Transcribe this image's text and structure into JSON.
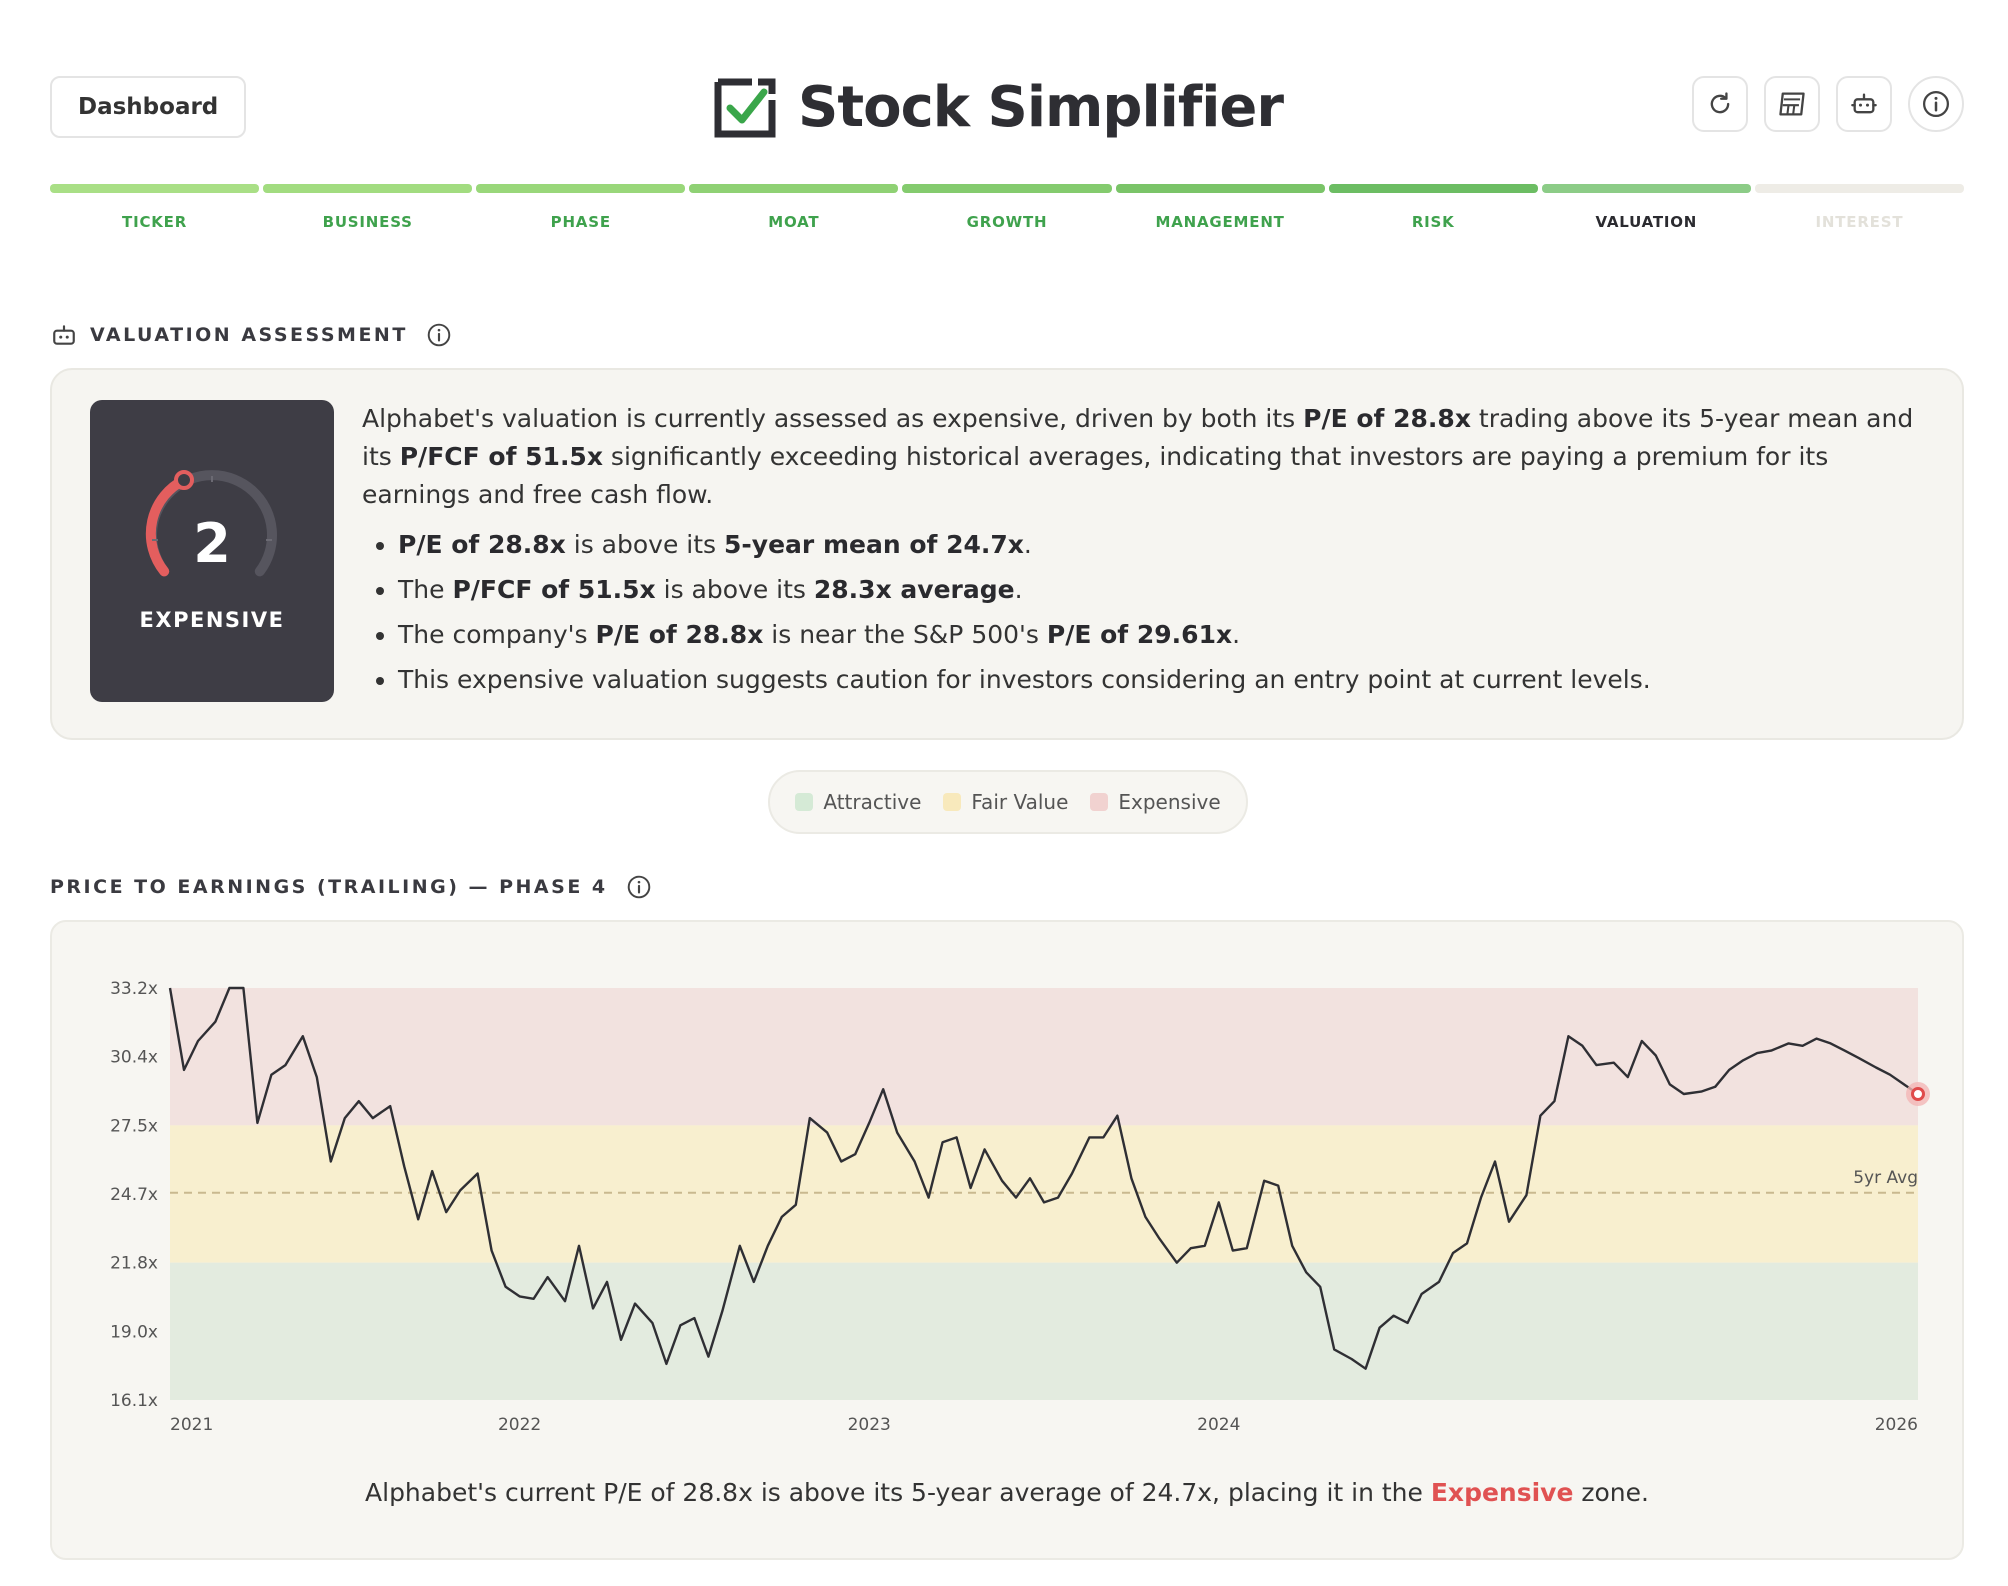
{
  "header": {
    "dashboard_label": "Dashboard",
    "brand_title": "Stock Simplifier",
    "icons": [
      "refresh-icon",
      "calculator-icon",
      "robot-icon",
      "info-icon"
    ]
  },
  "steps": [
    {
      "label": "TICKER",
      "state": "done"
    },
    {
      "label": "BUSINESS",
      "state": "done"
    },
    {
      "label": "PHASE",
      "state": "done"
    },
    {
      "label": "MOAT",
      "state": "done"
    },
    {
      "label": "GROWTH",
      "state": "done"
    },
    {
      "label": "MANAGEMENT",
      "state": "done"
    },
    {
      "label": "RISK",
      "state": "done"
    },
    {
      "label": "VALUATION",
      "state": "current"
    },
    {
      "label": "INTEREST",
      "state": "todo"
    }
  ],
  "assessment": {
    "section_title": "VALUATION ASSESSMENT",
    "score": "2",
    "score_label": "EXPENSIVE",
    "summary": {
      "t1": "Alphabet's valuation is currently assessed as expensive, driven by both its ",
      "b1": "P/E of 28.8x",
      "t2": " trading above its 5-year mean and its ",
      "b2": "P/FCF of 51.5x",
      "t3": " significantly exceeding historical averages, indicating that investors are paying a premium for its earnings and free cash flow."
    },
    "bullets": [
      {
        "b1": "P/E of 28.8x",
        "t1": " is above its ",
        "b2": "5-year mean of 24.7x",
        "t2": "."
      },
      {
        "t0": "The ",
        "b1": "P/FCF of 51.5x",
        "t1": " is above its ",
        "b2": "28.3x average",
        "t2": "."
      },
      {
        "t0": "The company's ",
        "b1": "P/E of 28.8x",
        "t1": " is near the S&P 500's ",
        "b2": "P/E of 29.61x",
        "t2": "."
      },
      {
        "t0": "This expensive valuation suggests caution for investors considering an entry point at current levels."
      }
    ]
  },
  "legend": [
    {
      "label": "Attractive",
      "color": "#d5ead6"
    },
    {
      "label": "Fair Value",
      "color": "#f8e9bc"
    },
    {
      "label": "Expensive",
      "color": "#f1d2d0"
    }
  ],
  "chart_section_title": "PRICE TO EARNINGS (TRAILING) — PHASE 4",
  "chart_data": {
    "type": "line",
    "y_ticks": [
      "33.2x",
      "30.4x",
      "27.5x",
      "24.7x",
      "21.8x",
      "19.0x",
      "16.1x"
    ],
    "x_ticks": [
      "2021",
      "2022",
      "2023",
      "2024",
      "2026"
    ],
    "ylim": [
      16.1,
      33.2
    ],
    "zones": [
      {
        "name": "Expensive",
        "from": 27.5,
        "to": 33.2,
        "color": "#f2e2df"
      },
      {
        "name": "Fair Value",
        "from": 21.8,
        "to": 27.5,
        "color": "#f8efcf"
      },
      {
        "name": "Attractive",
        "from": 16.1,
        "to": 21.8,
        "color": "#e3ebdf"
      }
    ],
    "avg": {
      "label": "5yr Avg",
      "value": 24.7
    },
    "current": 28.8,
    "series": [
      {
        "x": [
          2021.0,
          2021.04,
          2021.08,
          2021.13,
          2021.17,
          2021.21,
          2021.25,
          2021.29,
          2021.33,
          2021.38,
          2021.42,
          2021.46,
          2021.5,
          2021.54,
          2021.58,
          2021.63,
          2021.67,
          2021.71,
          2021.75,
          2021.79,
          2021.83,
          2021.88,
          2021.92,
          2021.96,
          2022.0,
          2022.04,
          2022.08,
          2022.13,
          2022.17,
          2022.21,
          2022.25,
          2022.29,
          2022.33,
          2022.38,
          2022.42,
          2022.46,
          2022.5,
          2022.54,
          2022.58,
          2022.63,
          2022.67,
          2022.71,
          2022.75,
          2022.79,
          2022.83,
          2022.88,
          2022.92,
          2022.96,
          2023.0,
          2023.04,
          2023.08,
          2023.13,
          2023.17,
          2023.21,
          2023.25,
          2023.29,
          2023.33,
          2023.38,
          2023.42,
          2023.46,
          2023.5,
          2023.54,
          2023.58,
          2023.63,
          2023.67,
          2023.71,
          2023.75,
          2023.79,
          2023.83,
          2023.88,
          2023.92,
          2023.96,
          2024.0,
          2024.04,
          2024.08,
          2024.13,
          2024.17,
          2024.21,
          2024.25,
          2024.29,
          2024.33,
          2024.38,
          2024.42,
          2024.46,
          2024.5,
          2024.54,
          2024.58,
          2024.63,
          2024.67,
          2024.71,
          2024.75,
          2024.79,
          2024.83,
          2024.88,
          2024.92,
          2024.96,
          2025.0,
          2025.04,
          2025.08,
          2025.13,
          2025.17,
          2025.21,
          2025.25,
          2025.29,
          2025.33,
          2025.38,
          2025.42,
          2025.46,
          2025.5,
          2025.54,
          2025.58,
          2025.63,
          2025.67,
          2025.71,
          2025.75,
          2025.79,
          2025.83,
          2025.88,
          2025.92,
          2025.96,
          2026.0
        ],
        "values": [
          33.2,
          29.8,
          31.0,
          31.8,
          33.2,
          33.2,
          27.6,
          29.6,
          30.0,
          31.2,
          29.5,
          26.0,
          27.8,
          28.5,
          27.8,
          28.3,
          25.8,
          23.6,
          25.6,
          23.9,
          24.8,
          25.5,
          22.3,
          20.8,
          20.4,
          20.3,
          21.2,
          20.2,
          22.5,
          19.9,
          21.0,
          18.6,
          20.1,
          19.3,
          17.6,
          19.2,
          19.5,
          17.9,
          19.8,
          22.5,
          21.0,
          22.5,
          23.7,
          24.2,
          27.8,
          27.2,
          26.0,
          26.3,
          27.6,
          29.0,
          27.2,
          26.0,
          24.5,
          26.8,
          27.0,
          24.9,
          26.5,
          25.2,
          24.5,
          25.3,
          24.3,
          24.5,
          25.5,
          27.0,
          27.0,
          27.9,
          25.3,
          23.7,
          22.8,
          21.8,
          22.4,
          22.5,
          24.3,
          22.3,
          22.4,
          25.2,
          25.0,
          22.5,
          21.4,
          20.8,
          18.2,
          17.8,
          17.4,
          19.1,
          19.6,
          19.3,
          20.5,
          21.0,
          22.2,
          22.6,
          24.5,
          26.0,
          23.5,
          24.6,
          27.9,
          28.5,
          31.2,
          30.8,
          30.0,
          30.1,
          29.5,
          31.0,
          30.4,
          29.2,
          28.8,
          28.9,
          29.1,
          29.8,
          30.2,
          30.5,
          30.6,
          30.9,
          30.8,
          31.1,
          30.9,
          30.6,
          30.3,
          29.9,
          29.6,
          29.2,
          28.8
        ]
      }
    ]
  },
  "chart_caption": {
    "t1": "Alphabet's current P/E of 28.8x is above its 5-year average of 24.7x, placing it in the ",
    "hl": "Expensive",
    "t2": " zone."
  }
}
